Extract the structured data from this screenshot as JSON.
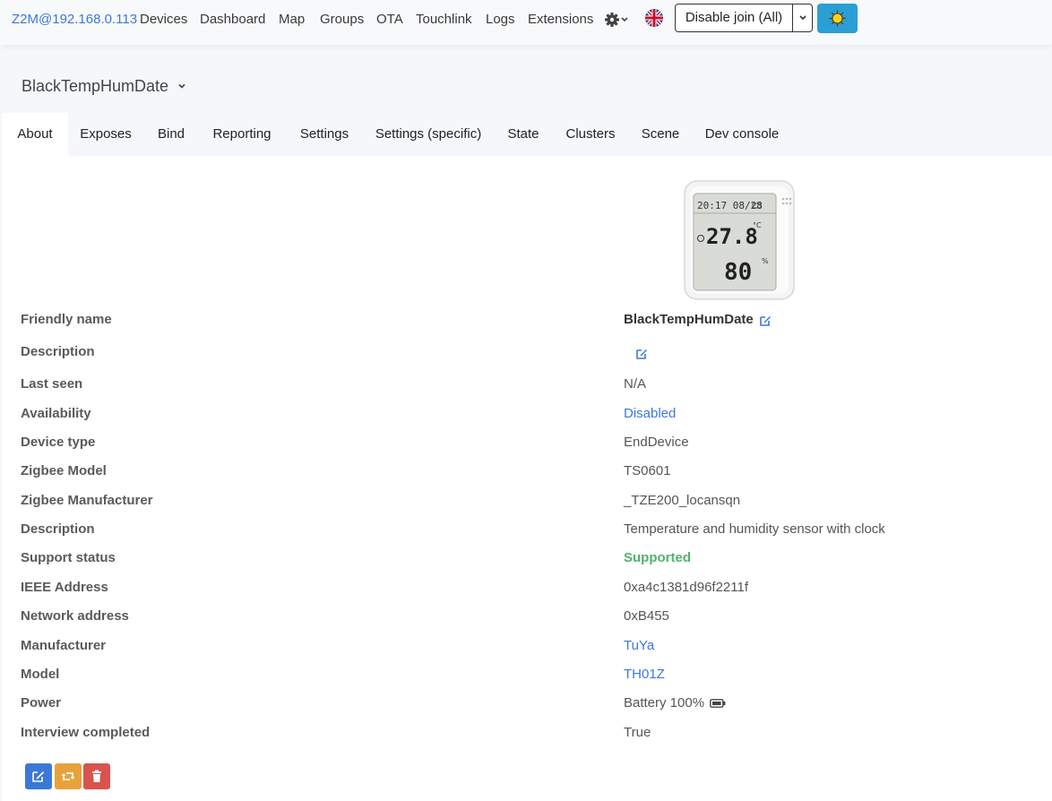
{
  "nav": {
    "brand": "Z2M@192.168.0.113",
    "links": [
      "Devices",
      "Dashboard",
      "Map",
      "Groups",
      "OTA",
      "Touchlink",
      "Logs",
      "Extensions"
    ],
    "join_label": "Disable join (All)"
  },
  "device": {
    "title": "BlackTempHumDate",
    "image_lcd_time": "20:17 08/28",
    "image_lcd_temp": "27.8",
    "image_lcd_temp_unit": "°C",
    "image_lcd_hum": "80",
    "image_lcd_hum_unit": "%"
  },
  "tabs": [
    "About",
    "Exposes",
    "Bind",
    "Reporting",
    "Settings",
    "Settings (specific)",
    "State",
    "Clusters",
    "Scene",
    "Dev console"
  ],
  "about": {
    "rows": [
      {
        "label": "Friendly name",
        "value": "BlackTempHumDate"
      },
      {
        "label": "Description",
        "value": ""
      },
      {
        "label": "Last seen",
        "value": "N/A"
      },
      {
        "label": "Availability",
        "value": "Disabled"
      },
      {
        "label": "Device type",
        "value": "EndDevice"
      },
      {
        "label": "Zigbee Model",
        "value": "TS0601"
      },
      {
        "label": "Zigbee Manufacturer",
        "value": "_TZE200_locansqn"
      },
      {
        "label": "Description",
        "value": "Temperature and humidity sensor with clock"
      },
      {
        "label": "Support status",
        "value": "Supported"
      },
      {
        "label": "IEEE Address",
        "value": "0xa4c1381d96f2211f"
      },
      {
        "label": "Network address",
        "value": "0xB455"
      },
      {
        "label": "Manufacturer",
        "value": "TuYa"
      },
      {
        "label": "Model",
        "value": "TH01Z"
      },
      {
        "label": "Power",
        "value": "Battery 100%"
      },
      {
        "label": "Interview completed",
        "value": "True"
      }
    ]
  },
  "colors": {
    "accent": "#3b78d8",
    "success": "#4fb36b",
    "warning": "#e9a23b",
    "danger": "#d9534f",
    "info": "#2a9fd6"
  }
}
